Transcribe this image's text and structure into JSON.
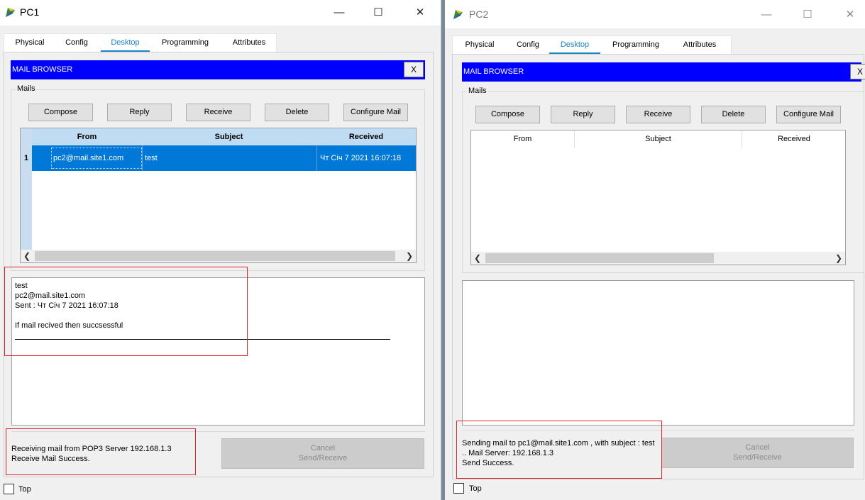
{
  "pc1": {
    "title": "PC1",
    "window_controls": {
      "minimize": "—",
      "maximize": "☐",
      "close": "✕"
    },
    "tabs": [
      "Physical",
      "Config",
      "Desktop",
      "Programming",
      "Attributes"
    ],
    "active_tab": "Desktop",
    "mail_browser": {
      "header": "MAIL BROWSER",
      "close_label": "X",
      "group_label": "Mails",
      "buttons": {
        "compose": "Compose",
        "reply": "Reply",
        "receive": "Receive",
        "delete": "Delete",
        "configure": "Configure Mail"
      },
      "columns": [
        "From",
        "Subject",
        "Received"
      ],
      "rows": [
        {
          "num": "1",
          "from": "pc2@mail.site1.com",
          "subject": "test",
          "received": "Чт Січ 7 2021 16:07:18"
        }
      ],
      "message": {
        "subject": "test",
        "from": "pc2@mail.site1.com",
        "sent": "Sent : Чт Січ 7 2021 16:07:18",
        "body": "If mail recived then succsessful"
      },
      "status": [
        "Receiving mail from POP3 Server 192.168.1.3",
        "Receive Mail Success."
      ],
      "cancel_button": [
        "Cancel",
        "Send/Receive"
      ]
    },
    "top_checkbox": {
      "label": "Top",
      "checked": false
    }
  },
  "pc2": {
    "title": "PC2",
    "window_controls": {
      "minimize": "—",
      "maximize": "☐",
      "close": "✕"
    },
    "tabs": [
      "Physical",
      "Config",
      "Desktop",
      "Programming",
      "Attributes"
    ],
    "active_tab": "Desktop",
    "mail_browser": {
      "header": "MAIL BROWSER",
      "close_label": "X",
      "group_label": "Mails",
      "buttons": {
        "compose": "Compose",
        "reply": "Reply",
        "receive": "Receive",
        "delete": "Delete",
        "configure": "Configure Mail"
      },
      "columns": [
        "From",
        "Subject",
        "Received"
      ],
      "status": [
        "Sending mail to pc1@mail.site1.com , with subject : test",
        "..    Mail Server: 192.168.1.3",
        "Send Success."
      ],
      "cancel_button": [
        "Cancel",
        "Send/Receive"
      ]
    },
    "top_checkbox": {
      "label": "Top",
      "checked": false
    }
  },
  "colors": {
    "header_blue": "#0000ff",
    "selection_blue": "#0078d7",
    "tab_accent": "#1a84c8",
    "highlight_red": "#d9262c"
  },
  "icons": [
    "packet-tracer-app-icon",
    "minimize-icon",
    "maximize-icon",
    "close-icon",
    "scroll-left-icon",
    "scroll-right-icon"
  ]
}
